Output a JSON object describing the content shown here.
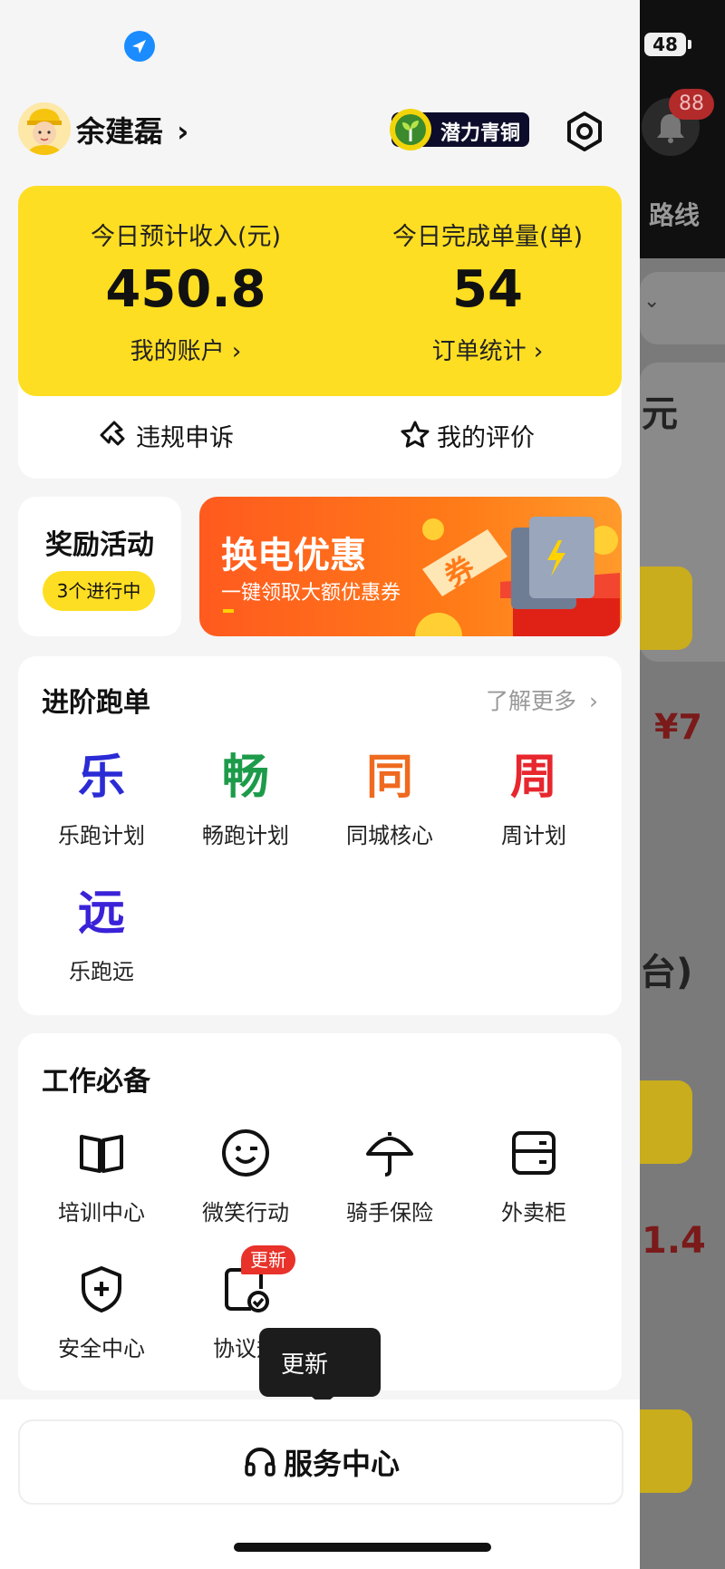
{
  "status_bar": {
    "battery": "48"
  },
  "header": {
    "user_name": "余建磊",
    "chevron": "›",
    "level_badge": "潜力青铜"
  },
  "income": {
    "label": "今日预计收入(元)",
    "value": "450.8",
    "link": "我的账户 ›"
  },
  "orders": {
    "label": "今日完成单量(单)",
    "value": "54",
    "link": "订单统计 ›"
  },
  "quick_links": {
    "appeal": "违规申诉",
    "rating": "我的评价"
  },
  "rewards": {
    "title": "奖励活动",
    "badge": "3个进行中"
  },
  "banner": {
    "title": "换电优惠",
    "subtitle": "一键领取大额优惠券",
    "ticket": "券"
  },
  "advanced": {
    "title": "进阶跑单",
    "more": "了解更多",
    "items": [
      {
        "char": "乐",
        "label": "乐跑计划",
        "color": "#2b2bd6"
      },
      {
        "char": "畅",
        "label": "畅跑计划",
        "color": "#1d9b4a"
      },
      {
        "char": "同",
        "label": "同城核心",
        "color": "#ef6a1f"
      },
      {
        "char": "周",
        "label": "周计划",
        "color": "#e8262e"
      },
      {
        "char": "远",
        "label": "乐跑远",
        "color": "#3a22d8"
      }
    ]
  },
  "essentials": {
    "title": "工作必备",
    "items": [
      {
        "label": "培训中心",
        "icon": "book-icon"
      },
      {
        "label": "微笑行动",
        "icon": "smile-icon"
      },
      {
        "label": "骑手保险",
        "icon": "umbrella-icon"
      },
      {
        "label": "外卖柜",
        "icon": "locker-icon"
      },
      {
        "label": "安全中心",
        "icon": "shield-icon"
      },
      {
        "label": "协议规",
        "icon": "agreement-icon"
      }
    ],
    "new_badge": "更新"
  },
  "tooltip": {
    "text": "更新"
  },
  "service": {
    "label": "服务中心"
  },
  "background_app": {
    "notification_count": "88",
    "route_tab": "路线",
    "text_yuan": "元",
    "price": "¥7",
    "text_tai": "台)",
    "number": "1.4"
  }
}
